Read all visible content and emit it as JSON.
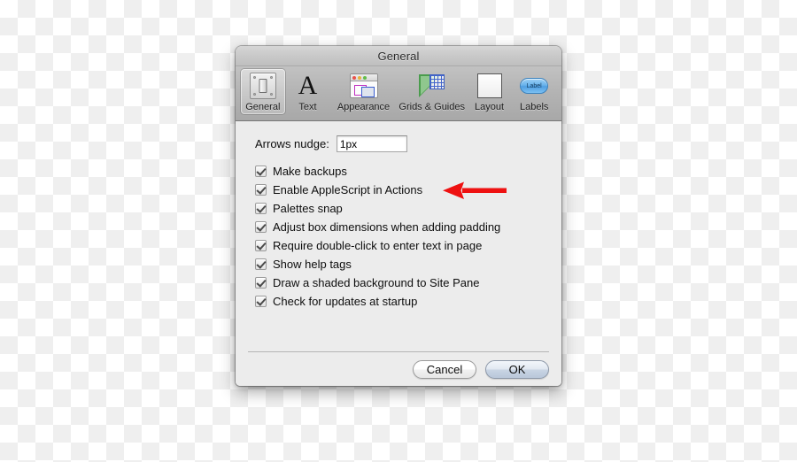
{
  "window": {
    "title": "General"
  },
  "toolbar": {
    "items": [
      {
        "label": "General",
        "icon": "light-switch-icon",
        "selected": true
      },
      {
        "label": "Text",
        "icon": "letter-a-icon",
        "selected": false
      },
      {
        "label": "Appearance",
        "icon": "window-icon",
        "selected": false
      },
      {
        "label": "Grids & Guides",
        "icon": "grid-triangle-icon",
        "selected": false
      },
      {
        "label": "Layout",
        "icon": "page-icon",
        "selected": false
      },
      {
        "label": "Labels",
        "icon": "label-pill-icon",
        "selected": false
      }
    ],
    "label_icon_text": "Label"
  },
  "settings": {
    "nudge_label": "Arrows nudge:",
    "nudge_value": "1px",
    "nudge_placeholder": "1px",
    "checkboxes": [
      {
        "label": "Make backups",
        "checked": true
      },
      {
        "label": "Enable AppleScript in Actions",
        "checked": true
      },
      {
        "label": "Palettes snap",
        "checked": true
      },
      {
        "label": "Adjust box dimensions when adding padding",
        "checked": true
      },
      {
        "label": "Require double-click to enter text in page",
        "checked": true
      },
      {
        "label": "Show help tags",
        "checked": true
      },
      {
        "label": "Draw a shaded background to Site Pane",
        "checked": true
      },
      {
        "label": "Check for updates at startup",
        "checked": true
      }
    ]
  },
  "buttons": {
    "cancel": "Cancel",
    "ok": "OK"
  },
  "annotation": {
    "arrow_color": "#ee1111",
    "points_to": "Enable AppleScript in Actions"
  }
}
